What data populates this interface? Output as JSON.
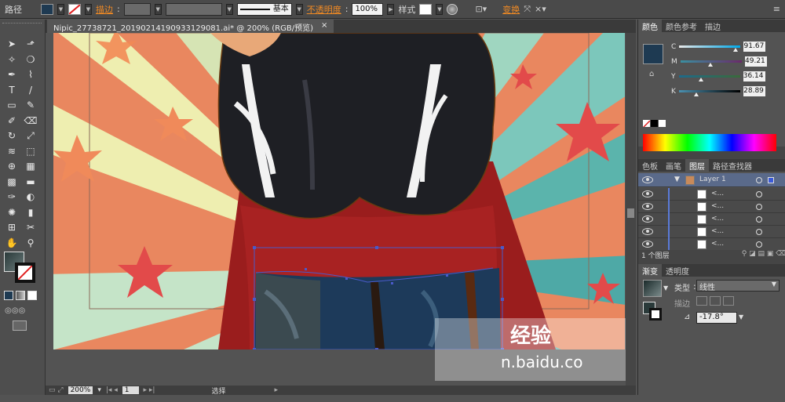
{
  "control_bar": {
    "path_label": "路径",
    "stroke_link": "描边",
    "stroke_style": "基本",
    "opacity_link": "不透明度",
    "opacity_value": "100%",
    "style_label": "样式",
    "transform_link": "变换",
    "fill_color": "#1e3a52"
  },
  "document": {
    "tab_title": "Nipic_27738721_20190214190933129081.ai* @ 200% (RGB/预览)",
    "close_glyph": "×"
  },
  "tools": [
    "select-tool",
    "direct-select-tool",
    "magic-wand-tool",
    "lasso-tool",
    "pen-tool",
    "curvature-tool",
    "type-tool",
    "line-tool",
    "rectangle-tool",
    "paintbrush-tool",
    "pencil-tool",
    "eraser-tool",
    "rotate-tool",
    "scale-tool",
    "warp-tool",
    "free-transform-tool",
    "shape-builder-tool",
    "perspective-tool",
    "mesh-tool",
    "gradient-tool",
    "eyedropper-tool",
    "blend-tool",
    "symbol-sprayer-tool",
    "graph-tool",
    "artboard-tool",
    "slice-tool",
    "hand-tool",
    "zoom-tool"
  ],
  "tool_glyphs": [
    "➤",
    "⬏",
    "✧",
    "❍",
    "✒",
    "⌇",
    "T",
    "/",
    "▭",
    "✎",
    "✐",
    "⌫",
    "↻",
    "⤢",
    "≋",
    "⬚",
    "⊕",
    "▦",
    "▩",
    "▬",
    "✑",
    "◐",
    "✺",
    "▮",
    "⊞",
    "✂",
    "✋",
    "⚲"
  ],
  "status_bar": {
    "zoom": "200%",
    "page": "1",
    "mode": "选择"
  },
  "color_panel": {
    "tabs": [
      "颜色",
      "颜色参考",
      "描边"
    ],
    "swatch": "#1e3a52",
    "channels": [
      {
        "name": "C",
        "value": "91.67",
        "gradient": "linear-gradient(90deg,#e8e8e8,#00a7e7)",
        "level": 0.917
      },
      {
        "name": "M",
        "value": "49.21",
        "gradient": "linear-gradient(90deg,#3a8fa0,#6a2a6a)",
        "level": 0.492
      },
      {
        "name": "Y",
        "value": "36.14",
        "gradient": "linear-gradient(90deg,#1e6a8a,#3a6a3a)",
        "level": 0.361
      },
      {
        "name": "K",
        "value": "28.89",
        "gradient": "linear-gradient(90deg,#4a90b0,#000000)",
        "level": 0.289
      }
    ]
  },
  "layers_panel": {
    "tabs": [
      "色板",
      "画笔",
      "图层",
      "路径查找器"
    ],
    "layer_name": "Layer 1",
    "sublayer_label": "<...",
    "sublayer_count": 5,
    "footer_text": "1 个图层"
  },
  "gradient_panel": {
    "tabs": [
      "渐变",
      "透明度"
    ],
    "type_label": "类型",
    "type_value": "线性",
    "stroke_label": "描边",
    "angle_value": "-17.8°"
  },
  "watermark": {
    "top": "经验",
    "bottom": "n.baidu.co"
  }
}
